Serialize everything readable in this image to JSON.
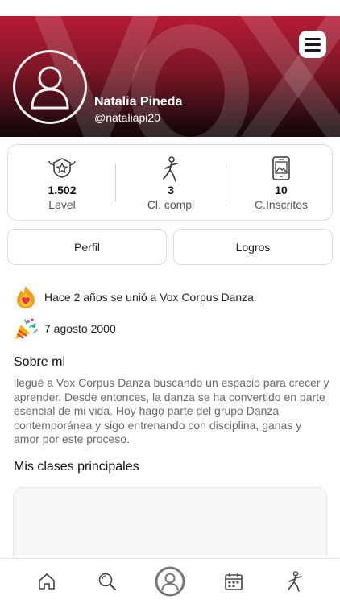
{
  "header": {
    "watermark_text": "VOX",
    "menu_icon": "hamburger-icon"
  },
  "profile": {
    "name": "Natalia Pineda",
    "handle": "@nataliapi20",
    "avatar_icon": "user-avatar-icon"
  },
  "stats": [
    {
      "icon": "badge-icon",
      "value": "1.502",
      "label": "Level"
    },
    {
      "icon": "dancer-icon",
      "value": "3",
      "label": "Cl. compl"
    },
    {
      "icon": "phone-image-icon",
      "value": "10",
      "label": "C.Inscritos"
    }
  ],
  "tabs": {
    "profile_label": "Perfil",
    "achievements_label": "Logros"
  },
  "info": {
    "joined_text": "Hace 2 años se unió a Vox Corpus Danza.",
    "birthday_text": "7 agosto 2000"
  },
  "about": {
    "title": "Sobre mi",
    "text": "llegué a Vox Corpus Danza buscando un espacio para crecer y aprender. Desde entonces, la danza se ha convertido en parte esencial de mi vida. Hoy hago parte del grupo Danza contemporánea y sigo entrenando con disciplina, ganas y amor por este proceso."
  },
  "classes": {
    "title": "Mis clases principales"
  },
  "nav": {
    "items": [
      "home-icon",
      "search-icon",
      "profile-icon",
      "calendar-icon",
      "dancer-icon"
    ]
  },
  "colors": {
    "hero_top": "#b51b33",
    "hero_bottom": "#120608",
    "text_muted": "#6a6a6a"
  }
}
